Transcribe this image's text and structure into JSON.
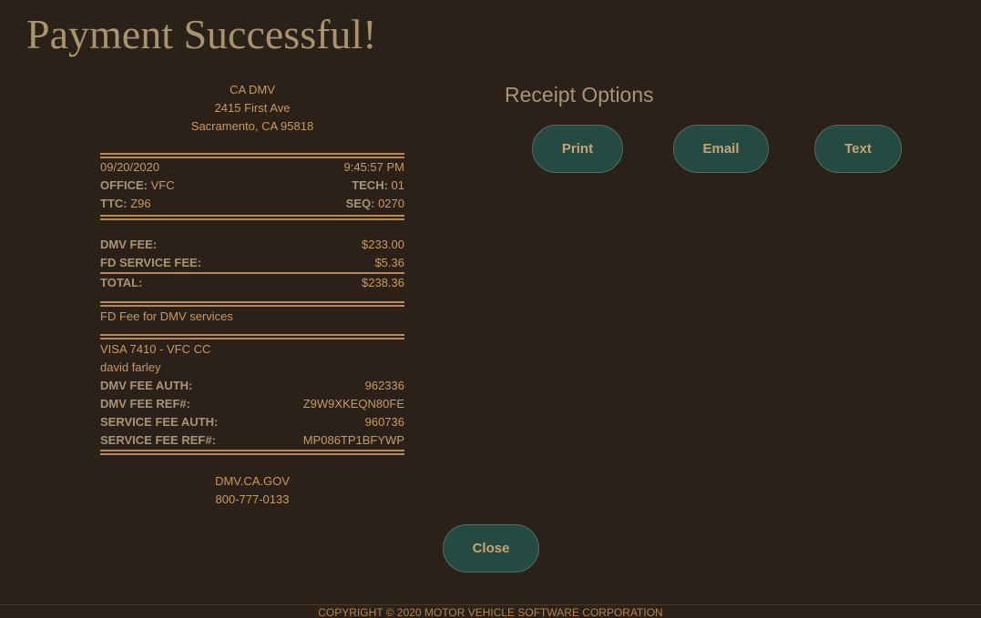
{
  "page": {
    "title": "Payment Successful!"
  },
  "receipt": {
    "header": {
      "agency": "CA DMV",
      "address_line1": "2415 First Ave",
      "address_line2": "Sacramento, CA 95818"
    },
    "date": "09/20/2020",
    "time": "9:45:57 PM",
    "office_label": "OFFICE:",
    "office_value": "VFC",
    "tech_label": "TECH:",
    "tech_value": "01",
    "ttc_label": "TTC:",
    "ttc_value": "Z96",
    "seq_label": "SEQ:",
    "seq_value": "0270",
    "fees": {
      "dmv_fee_label": "DMV FEE:",
      "dmv_fee_value": "$233.00",
      "service_fee_label": "FD SERVICE FEE:",
      "service_fee_value": "$5.36",
      "total_label": "TOTAL:",
      "total_value": "$238.36"
    },
    "note": "FD Fee for DMV services",
    "payment": {
      "card": "VISA 7410 - VFC CC",
      "cardholder": "david farley",
      "dmv_fee_auth_label": "DMV FEE AUTH:",
      "dmv_fee_auth_value": "962336",
      "dmv_fee_ref_label": "DMV FEE REF#:",
      "dmv_fee_ref_value": "Z9W9XKEQN80FE",
      "service_fee_auth_label": "SERVICE FEE AUTH:",
      "service_fee_auth_value": "960736",
      "service_fee_ref_label": "SERVICE FEE REF#:",
      "service_fee_ref_value": "MP086TP1BFYWP"
    },
    "footer": {
      "website": "DMV.CA.GOV",
      "phone": "800-777-0133"
    }
  },
  "receipt_options": {
    "title": "Receipt Options",
    "print_label": "Print",
    "email_label": "Email",
    "text_label": "Text"
  },
  "actions": {
    "close_label": "Close"
  },
  "footer": {
    "copyright": "COPYRIGHT © 2020 MOTOR VEHICLE SOFTWARE CORPORATION"
  },
  "colors": {
    "background": "#2c2118",
    "accent_text": "#c79a63",
    "button_fill": "#244a42",
    "title_text": "#a89470"
  }
}
